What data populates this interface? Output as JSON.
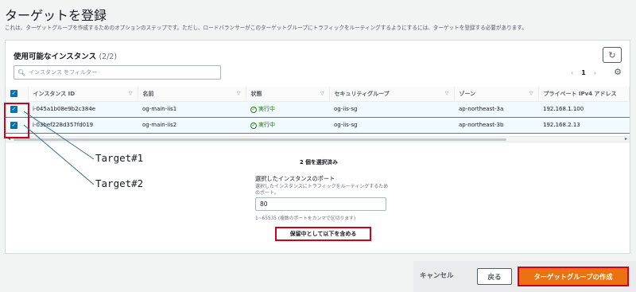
{
  "page": {
    "title": "ターゲットを登録",
    "description": "これは、ターゲットグループを作成するためのオプションのステップです。ただし、ロードバランサーがこのターゲットグループにトラフィックをルーティングするようにするには、ターゲットを登録する必要があります。"
  },
  "panel": {
    "title": "使用可能なインスタンス",
    "count": "(2/2)",
    "filter_placeholder": "インスタンス をフィルター",
    "page_number": "1"
  },
  "table": {
    "headers": [
      "インスタンス ID",
      "名前",
      "状態",
      "セキュリティグループ",
      "ゾーン",
      "プライベート IPv4 アドレス"
    ],
    "rows": [
      {
        "id": "i-045a1b08e9b2c384e",
        "name": "og-main-iis1",
        "state": "実行中",
        "sg": "og-iis-sg",
        "zone": "ap-northeast-3a",
        "ip": "192.168.1.100"
      },
      {
        "id": "i-03bef228d357fd019",
        "name": "og-main-iis2",
        "state": "実行中",
        "sg": "og-iis-sg",
        "zone": "ap-northeast-3b",
        "ip": "192.168.2.13"
      }
    ]
  },
  "selection": {
    "summary": "2 個を選択済み",
    "port_label": "選択したインスタンスのポート",
    "port_desc": "選択したインスタンスにトラフィックをルーティングするためのポート。",
    "port_value": "80",
    "port_hint": "1~65535 (複数のポートをカンマで区切ります)",
    "include_button": "保留中として以下を含める"
  },
  "annotations": {
    "target1": "Target#1",
    "target2": "Target#2",
    "color": "#d0021b"
  },
  "footer": {
    "cancel": "キャンセル",
    "back": "戻る",
    "create": "ターゲットグループの作成"
  },
  "colors": {
    "primary": "#ec7211",
    "checkbox": "#0073bb",
    "running": "#1d8102"
  }
}
